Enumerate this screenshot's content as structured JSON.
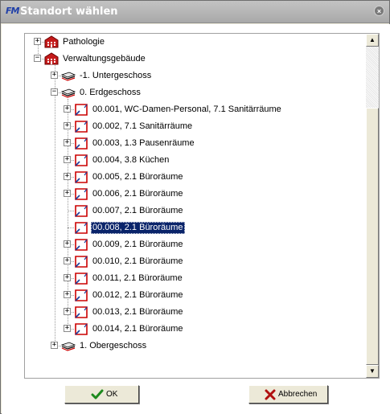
{
  "window": {
    "title": "Standort wählen",
    "app_icon_text": "FM",
    "close_glyph": "×"
  },
  "tree": {
    "nodes": [
      {
        "label": "Pathologie",
        "icon": "building-icon",
        "expander": "+",
        "level": 1
      },
      {
        "label": "Verwaltungsgebäude",
        "icon": "building-icon",
        "expander": "−",
        "level": 1
      },
      {
        "label": "-1. Untergeschoss",
        "icon": "floor-icon",
        "expander": "+",
        "level": 2
      },
      {
        "label": "0. Erdgeschoss",
        "icon": "floor-icon",
        "expander": "−",
        "level": 2
      },
      {
        "label": "00.001, WC-Damen-Personal, 7.1 Sanitärräume",
        "icon": "room-icon",
        "expander": "+",
        "level": 3
      },
      {
        "label": "00.002, 7.1 Sanitärräume",
        "icon": "room-icon",
        "expander": "+",
        "level": 3
      },
      {
        "label": "00.003, 1.3 Pausenräume",
        "icon": "room-icon",
        "expander": "+",
        "level": 3
      },
      {
        "label": "00.004, 3.8 Küchen",
        "icon": "room-icon",
        "expander": "+",
        "level": 3
      },
      {
        "label": "00.005, 2.1 Büroräume",
        "icon": "room-icon",
        "expander": "+",
        "level": 3
      },
      {
        "label": "00.006, 2.1 Büroräume",
        "icon": "room-icon",
        "expander": "+",
        "level": 3
      },
      {
        "label": "00.007, 2.1 Büroräume",
        "icon": "room-icon",
        "expander": "",
        "level": 3
      },
      {
        "label": "00.008, 2.1 Büroräume",
        "icon": "room-icon",
        "expander": "",
        "level": 3,
        "selected": true
      },
      {
        "label": "00.009, 2.1 Büroräume",
        "icon": "room-icon",
        "expander": "+",
        "level": 3
      },
      {
        "label": "00.010, 2.1 Büroräume",
        "icon": "room-icon",
        "expander": "+",
        "level": 3
      },
      {
        "label": "00.011, 2.1 Büroräume",
        "icon": "room-icon",
        "expander": "+",
        "level": 3
      },
      {
        "label": "00.012, 2.1 Büroräume",
        "icon": "room-icon",
        "expander": "+",
        "level": 3
      },
      {
        "label": "00.013, 2.1 Büroräume",
        "icon": "room-icon",
        "expander": "+",
        "level": 3
      },
      {
        "label": "00.014, 2.1 Büroräume",
        "icon": "room-icon",
        "expander": "+",
        "level": 3
      },
      {
        "label": "1. Obergeschoss",
        "icon": "floor-icon",
        "expander": "+",
        "level": 2
      }
    ]
  },
  "scrollbar": {
    "up_glyph": "▲",
    "down_glyph": "▼"
  },
  "buttons": {
    "ok": {
      "label": "OK",
      "icon": "check-icon"
    },
    "cancel": {
      "label": "Abbrechen",
      "icon": "cross-icon"
    }
  },
  "colors": {
    "selection": "#0a246a",
    "room_icon_red": "#cc0000",
    "building_red": "#c41a1a"
  }
}
